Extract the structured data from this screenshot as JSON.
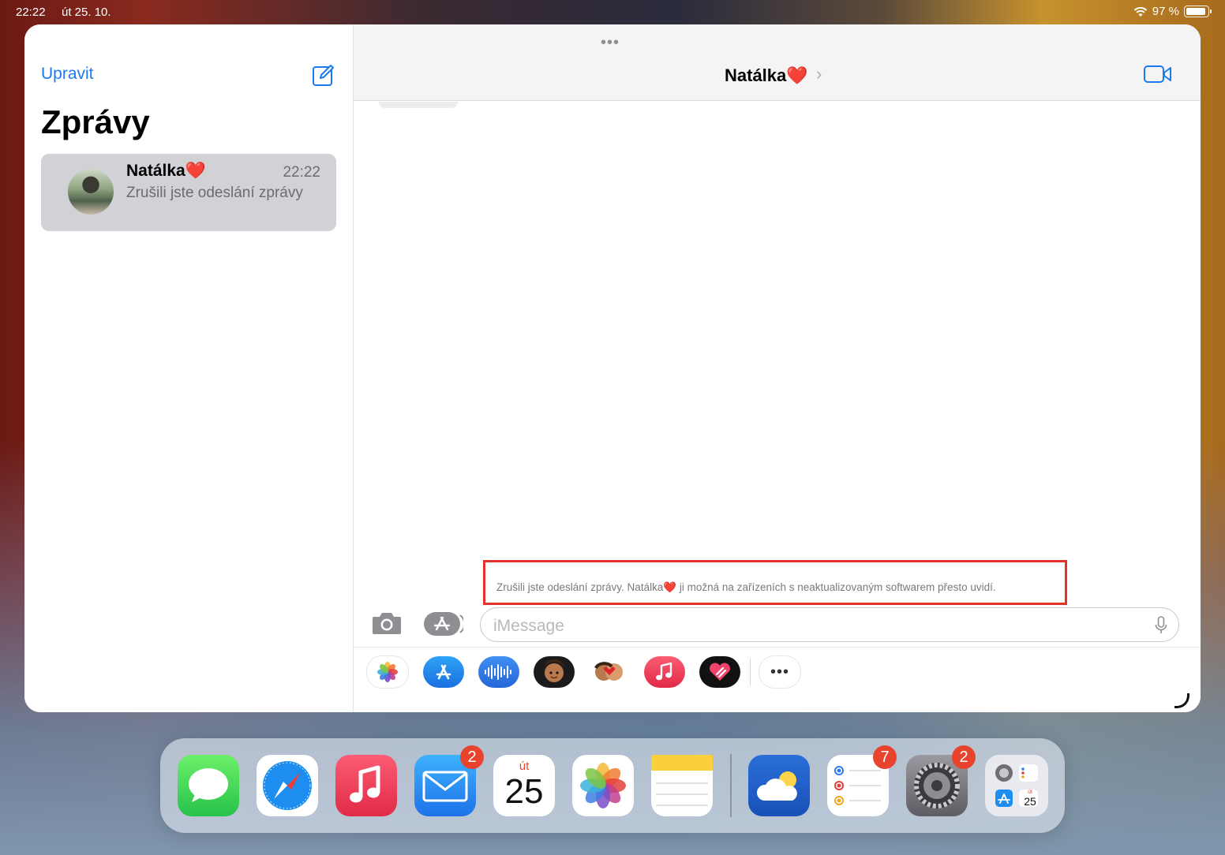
{
  "status_bar": {
    "time": "22:22",
    "date": "út 25. 10.",
    "battery": "97 %"
  },
  "sidebar": {
    "edit_label": "Upravit",
    "title": "Zprávy",
    "conversations": [
      {
        "name": "Natálka",
        "name_emoji": "❤️",
        "time": "22:22",
        "preview": "Zrušili jste odeslání zprávy"
      }
    ]
  },
  "chat": {
    "grab_dots": "•••",
    "contact_name": "Natálka",
    "contact_emoji": "❤️",
    "chevron": "›",
    "notice_text_1": "Zrušili jste odeslání zprávy. Natálka",
    "notice_emoji": "❤️",
    "notice_text_2": " ji možná na zařízeních s neaktualizovaným softwarem přesto uvidí.",
    "input_placeholder": "iMessage",
    "more_label": "•••"
  },
  "app_strip": [
    "photos-app",
    "app-store-app",
    "audio-message-app",
    "memoji-app",
    "animoji-stickers-app",
    "music-app",
    "digital-touch-app",
    "more-apps"
  ],
  "dock": {
    "calendar_weekday": "út",
    "calendar_day": "25",
    "mail_badge": "2",
    "reminders_badge": "7",
    "settings_badge": "2",
    "folder_day": "25",
    "folder_weekday": "út"
  },
  "colors": {
    "accent": "#1b7aef",
    "highlight_border": "#e3322b",
    "badge": "#e8432d"
  }
}
